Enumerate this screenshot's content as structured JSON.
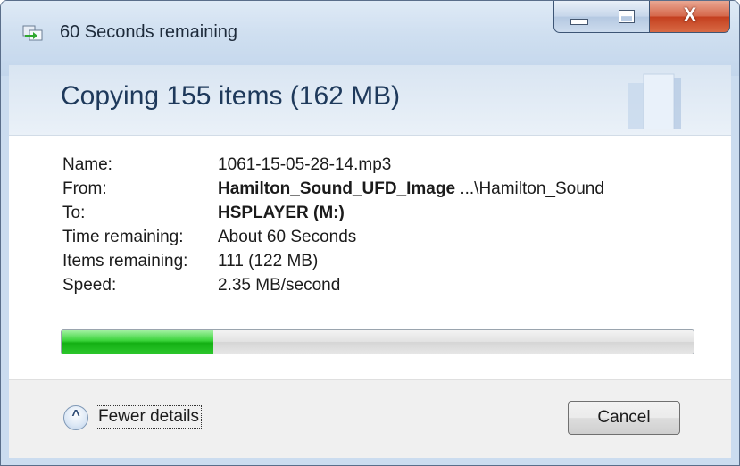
{
  "window": {
    "title": "60 Seconds remaining",
    "controls": {
      "minimize": "minimize",
      "maximize": "maximize",
      "close_glyph": "X"
    }
  },
  "header": {
    "title": "Copying 155 items (162 MB)"
  },
  "details": {
    "name": {
      "label": "Name:",
      "value": "1061-15-05-28-14.mp3"
    },
    "from": {
      "label": "From:",
      "value_bold": "Hamilton_Sound_UFD_Image",
      "value_path": " ...\\Hamilton_Sound"
    },
    "to": {
      "label": "To:",
      "value": "HSPLAYER (M:)"
    },
    "time_remaining": {
      "label": "Time remaining:",
      "value": "About 60 Seconds"
    },
    "items_remaining": {
      "label": "Items remaining:",
      "value": "111 (122 MB)"
    },
    "speed": {
      "label": "Speed:",
      "value": "2.35 MB/second"
    }
  },
  "progress": {
    "fraction": 0.24,
    "color": "#2bc62b"
  },
  "footer": {
    "fewer_details_label": "Fewer details",
    "cancel_label": "Cancel"
  },
  "icons": [
    "copy-icon",
    "chevron-up-icon",
    "minimize-icon",
    "maximize-icon",
    "close-icon"
  ]
}
